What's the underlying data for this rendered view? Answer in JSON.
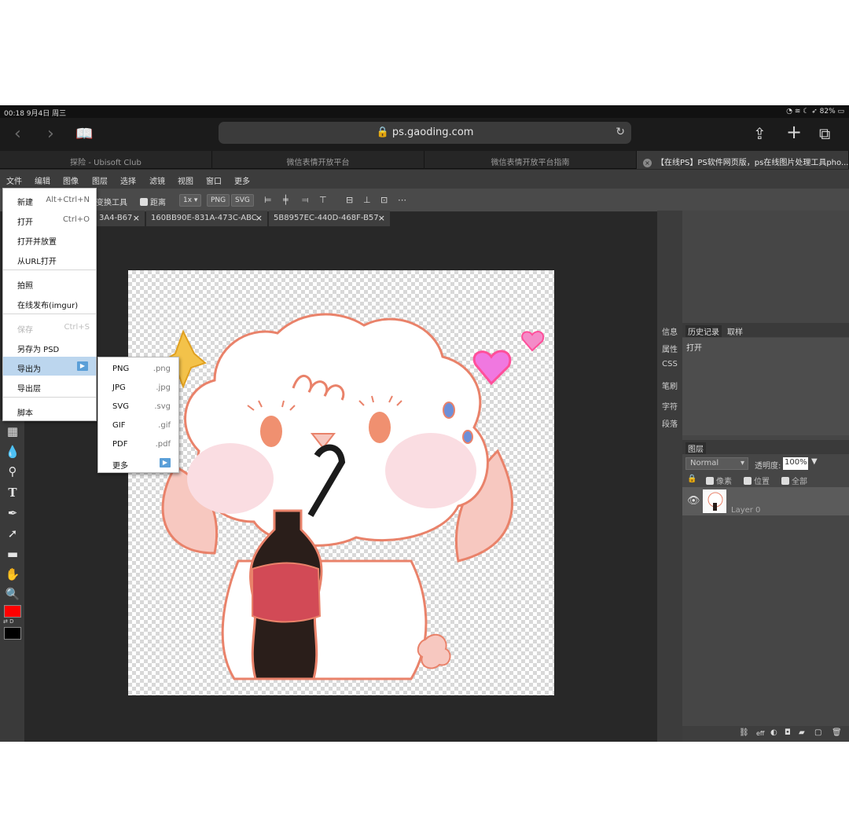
{
  "status_bar": {
    "time_date": "00:18  9月4日 周三",
    "right": "◔ ≋ ☾ ➶ 82% ▭"
  },
  "browser": {
    "back_icon": "‹",
    "forward_icon": "›",
    "bookmarks_icon": "📖",
    "url": "🔒 ps.gaoding.com",
    "reload_icon": "↻",
    "share_icon": "⇪",
    "new_tab_icon": "+",
    "tabs_icon": "⧉",
    "tabs": [
      "探险 - Ubisoft Club",
      "微信表情开放平台",
      "微信表情开放平台指南",
      "【在线PS】PS软件网页版，ps在线图片处理工具pho..."
    ]
  },
  "menubar": [
    "文件",
    "编辑",
    "图像",
    "图层",
    "选择",
    "滤镜",
    "视图",
    "窗口",
    "更多"
  ],
  "options_bar": {
    "transform_tools": "变换工具",
    "distance": "距离",
    "zoom": "1x ▾",
    "png": "PNG",
    "svg": "SVG"
  },
  "doc_tabs": [
    {
      "label": "3A4-B67",
      "close": "×"
    },
    {
      "label": "160BB90E-831A-473C-ABC",
      "close": "×"
    },
    {
      "label": "5B8957EC-440D-468F-B57",
      "close": "×"
    }
  ],
  "file_menu": [
    {
      "label": "新建",
      "shortcut": "Alt+Ctrl+N"
    },
    {
      "label": "打开",
      "shortcut": "Ctrl+O"
    },
    {
      "label": "打开并放置",
      "shortcut": ""
    },
    {
      "label": "从URL打开",
      "shortcut": ""
    },
    {
      "label": "拍照",
      "shortcut": ""
    },
    {
      "label": "在线发布(imgur)",
      "shortcut": ""
    },
    {
      "label": "保存",
      "shortcut": "Ctrl+S"
    },
    {
      "label": "另存为 PSD",
      "shortcut": ""
    },
    {
      "label": "导出为",
      "shortcut": ""
    },
    {
      "label": "导出层",
      "shortcut": ""
    },
    {
      "label": "脚本",
      "shortcut": ""
    }
  ],
  "export_menu": [
    {
      "label": "PNG",
      "ext": ".png"
    },
    {
      "label": "JPG",
      "ext": ".jpg"
    },
    {
      "label": "SVG",
      "ext": ".svg"
    },
    {
      "label": "GIF",
      "ext": ".gif"
    },
    {
      "label": "PDF",
      "ext": ".pdf"
    },
    {
      "label": "更多",
      "ext": ""
    }
  ],
  "side_panel": [
    "信息",
    "属性",
    "CSS",
    "笔刷",
    "字符",
    "段落"
  ],
  "history_panel": {
    "tabs": [
      "历史记录",
      "取样"
    ],
    "entries": [
      "打开"
    ]
  },
  "layers_panel": {
    "title": "图层",
    "blend_mode": "Normal",
    "opacity_label": "透明度:",
    "opacity_value": "100%",
    "lock_options": [
      "像素",
      "位置",
      "全部"
    ],
    "layer_name": "Layer 0"
  },
  "footer_icons": {
    "link": "⛓",
    "eff": "eff"
  },
  "colors": {
    "foreground": "#ff0000",
    "background": "#000000",
    "highlight": "#bcd6ee"
  }
}
